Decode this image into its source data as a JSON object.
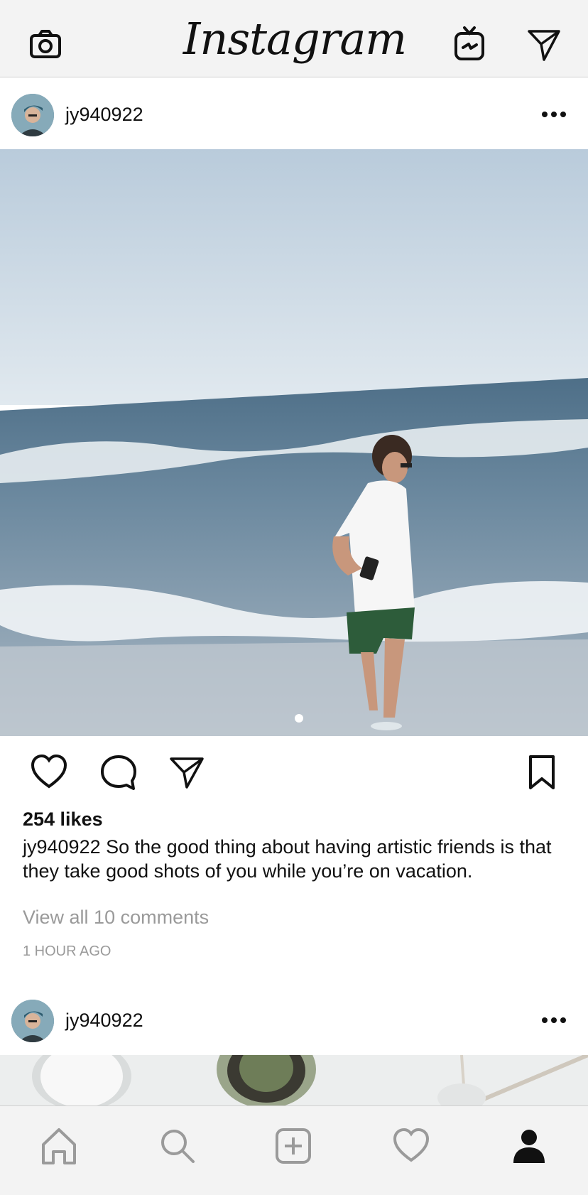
{
  "header": {
    "app_title": "Instagram",
    "icons": [
      "camera-icon",
      "igtv-icon",
      "direct-message-icon"
    ]
  },
  "feed": {
    "post1": {
      "username": "jy940922",
      "likes": "254 likes",
      "caption_user": "jy940922",
      "caption_text": "So the good thing about having artistic friends is that they take good shots of you while you’re on vacation.",
      "view_comments": "View all 10 comments",
      "timestamp": "1 HOUR AGO",
      "carousel_position": 1
    },
    "post2": {
      "username": "jy940922"
    }
  },
  "bottom_nav": {
    "items": [
      "home-icon",
      "search-icon",
      "new-post-icon",
      "activity-icon",
      "profile-icon"
    ],
    "active": "profile-icon"
  },
  "colors": {
    "bar_background": "#f3f3f3",
    "text": "#111111",
    "muted_text": "#9a9a9a",
    "inactive_icon": "#9a9a9a"
  }
}
